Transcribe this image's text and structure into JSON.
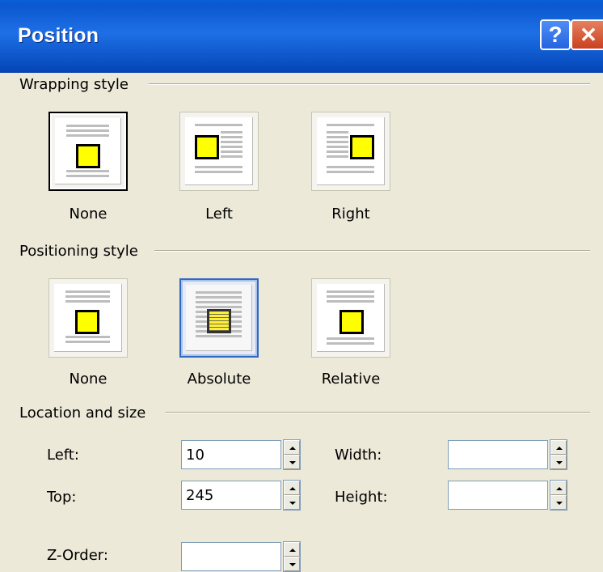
{
  "window": {
    "title": "Position",
    "help_glyph": "?",
    "close_glyph": "✕"
  },
  "wrapping": {
    "label": "Wrapping style",
    "options": [
      {
        "label": "None",
        "icon": "wrap-none-icon",
        "state": "pressed"
      },
      {
        "label": "Left",
        "icon": "wrap-left-icon",
        "state": "normal"
      },
      {
        "label": "Right",
        "icon": "wrap-right-icon",
        "state": "normal"
      }
    ]
  },
  "positioning": {
    "label": "Positioning style",
    "options": [
      {
        "label": "None",
        "icon": "position-none-icon",
        "state": "normal"
      },
      {
        "label": "Absolute",
        "icon": "position-absolute-icon",
        "state": "selected"
      },
      {
        "label": "Relative",
        "icon": "position-relative-icon",
        "state": "normal"
      }
    ]
  },
  "location": {
    "label": "Location and size",
    "left_label": "Left:",
    "left_value": "10",
    "top_label": "Top:",
    "top_value": "245",
    "width_label": "Width:",
    "width_value": "",
    "height_label": "Height:",
    "height_value": "",
    "zorder_label": "Z-Order:",
    "zorder_value": ""
  },
  "colors": {
    "title_bar": "#0a5fd8",
    "selected_border": "#3169c6",
    "dialog_bg": "#ece9d8",
    "object_fill": "#ffff00"
  }
}
